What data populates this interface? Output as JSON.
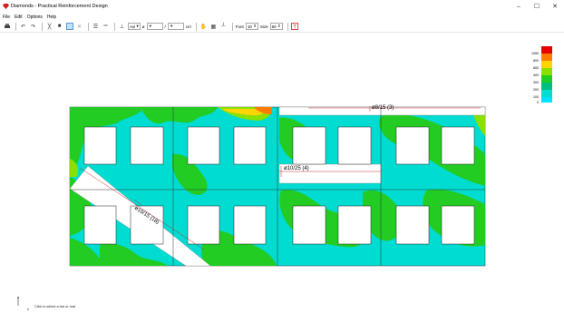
{
  "window": {
    "title": "Diamonds - Practical Reinforcement Design",
    "minimize": "–",
    "maximize": "☐",
    "close": "✕"
  },
  "menu": [
    "File",
    "Edit",
    "Options",
    "Help"
  ],
  "toolbar": {
    "axis_select": "Axi",
    "diameter_symbol": "ø",
    "diameter_value": "",
    "spacing_value": "",
    "unit": "cm",
    "font_label": "Font",
    "font_value": "10",
    "size_label": "Size",
    "size_value": "60"
  },
  "legend": {
    "values": [
      "1050",
      "800",
      "600",
      "400",
      "300",
      "200",
      "100",
      "0"
    ],
    "colors": [
      "#e60000",
      "#ff7a00",
      "#ffd400",
      "#8ae000",
      "#22cc22",
      "#00c080",
      "#00dcd2",
      "#00e0ff"
    ]
  },
  "annotations": {
    "bar_top": "ø8/15 (3)",
    "bar_middle": "ø10/25 (4)",
    "bar_diagonal": "ø10/15 (18)"
  },
  "axes": {
    "y": "z",
    "x": "x"
  },
  "status": "Click to select a bar or mat"
}
